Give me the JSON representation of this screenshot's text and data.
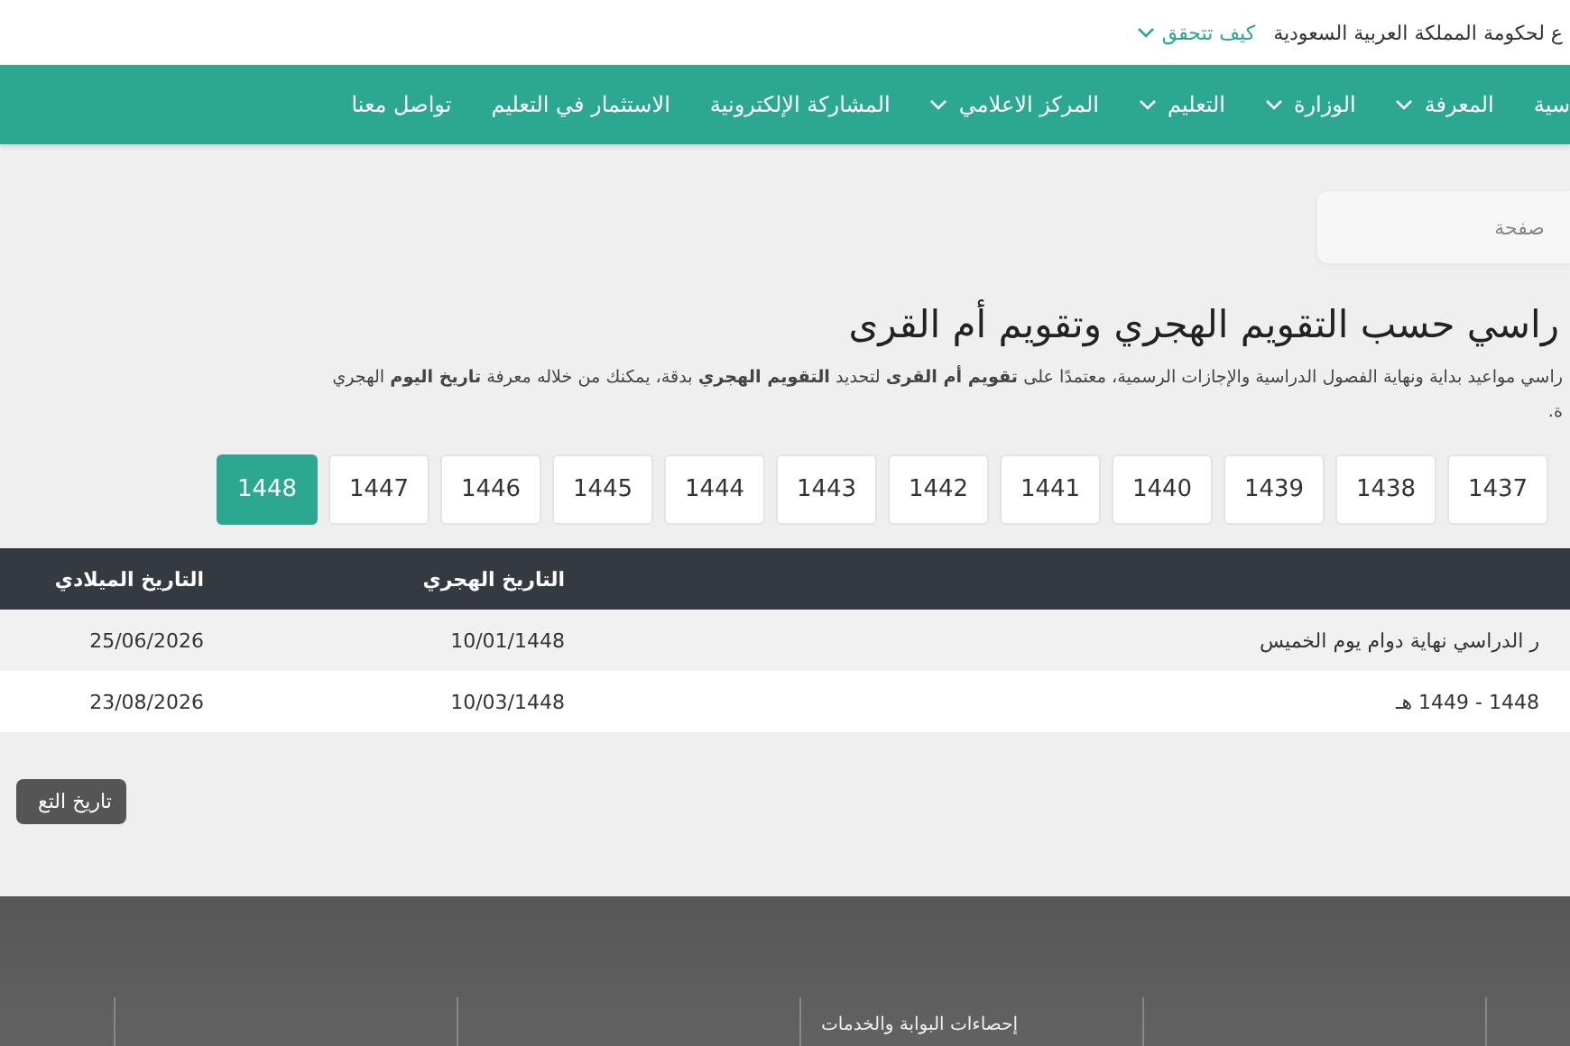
{
  "top_bar": {
    "text": "ع لحكومة المملكة العربية السعودية",
    "link": "كيف تتحقق"
  },
  "nav": [
    {
      "label": "سية",
      "dropdown": false
    },
    {
      "label": "المعرفة",
      "dropdown": true
    },
    {
      "label": "الوزارة",
      "dropdown": true
    },
    {
      "label": "التعليم",
      "dropdown": true
    },
    {
      "label": "المركز الاعلامي",
      "dropdown": true
    },
    {
      "label": "المشاركة الإلكترونية",
      "dropdown": false
    },
    {
      "label": "الاستثمار في التعليم",
      "dropdown": false
    },
    {
      "label": "تواصل معنا",
      "dropdown": false
    }
  ],
  "search": {
    "placeholder": "صفحة"
  },
  "heading": "راسي حسب التقويم الهجري وتقويم أم القرى",
  "paragraph": [
    "راسي مواعيد بداية ونهاية الفصول الدراسية والإجازات الرسمية، معتمدًا على **تقويم أم القرى** لتحديد **التقويم الهجري** بدقة، يمكنك من خلاله معرفة **تاريخ اليوم** الهجري",
    "ة."
  ],
  "years": [
    {
      "label": "1437",
      "selected": false
    },
    {
      "label": "1438",
      "selected": false
    },
    {
      "label": "1439",
      "selected": false
    },
    {
      "label": "1440",
      "selected": false
    },
    {
      "label": "1441",
      "selected": false
    },
    {
      "label": "1442",
      "selected": false
    },
    {
      "label": "1443",
      "selected": false
    },
    {
      "label": "1444",
      "selected": false
    },
    {
      "label": "1445",
      "selected": false
    },
    {
      "label": "1446",
      "selected": false
    },
    {
      "label": "1447",
      "selected": false
    },
    {
      "label": "1448",
      "selected": true
    }
  ],
  "table": {
    "columns": [
      "",
      "التاريخ الهجري",
      "التاريخ الميلادي"
    ],
    "rows": [
      [
        "ر الدراسي نهاية دوام يوم الخميس",
        "10/01/1448",
        "25/06/2026"
      ],
      [
        "1448 - 1449 هـ",
        "10/03/1448",
        "23/08/2026"
      ]
    ]
  },
  "button": "تاريخ التع",
  "footer": {
    "heading": "إحصاءات البوابة والخدمات"
  }
}
